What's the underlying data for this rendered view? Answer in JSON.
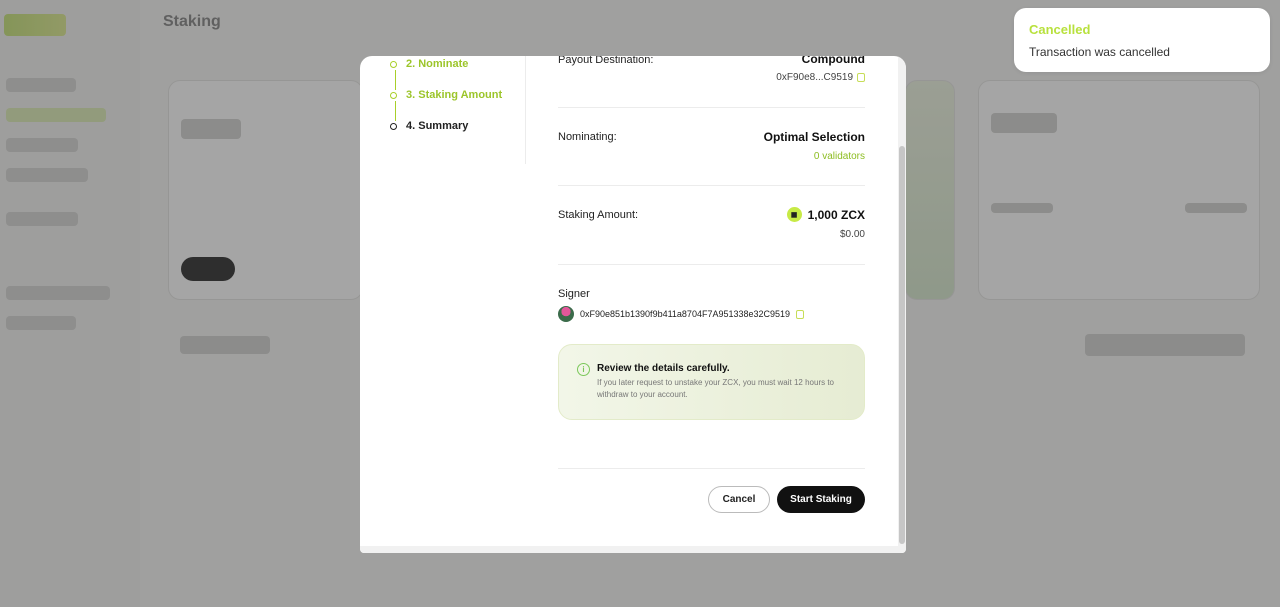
{
  "background": {
    "page_title": "Staking"
  },
  "modal": {
    "steps": [
      {
        "label": "2. Nominate",
        "state": "done"
      },
      {
        "label": "3. Staking Amount",
        "state": "done"
      },
      {
        "label": "4. Summary",
        "state": "current"
      }
    ],
    "payout": {
      "label": "Payout Destination:",
      "value": "Compound",
      "address": "0xF90e8...C9519"
    },
    "nominating": {
      "label": "Nominating:",
      "value": "Optimal Selection",
      "sub": "0 validators"
    },
    "staking_amount": {
      "label": "Staking Amount:",
      "value": "1,000 ZCX",
      "sub": "$0.00",
      "coin_icon": "zcx-coin-icon"
    },
    "signer": {
      "label": "Signer",
      "address": "0xF90e851b1390f9b411a8704F7A951338e32C9519"
    },
    "notice": {
      "title": "Review the details carefully.",
      "body": "If you later request to unstake your ZCX, you must wait 12 hours to withdraw to your account."
    },
    "buttons": {
      "cancel": "Cancel",
      "start": "Start Staking"
    }
  },
  "toast": {
    "title": "Cancelled",
    "message": "Transaction was cancelled",
    "title_color": "#b8e13d"
  },
  "colors": {
    "accent": "#a8cf2a",
    "primary_button": "#111111"
  }
}
